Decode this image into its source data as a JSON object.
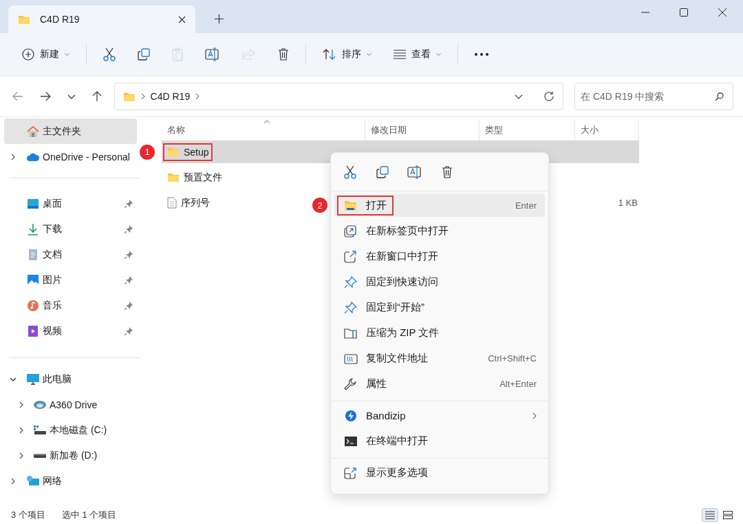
{
  "window": {
    "tab_title": "C4D R19"
  },
  "toolbar": [
    {
      "kind": "new",
      "label": "新建",
      "disabled": false
    },
    {
      "kind": "cut",
      "disabled": false
    },
    {
      "kind": "copy",
      "disabled": false
    },
    {
      "kind": "paste",
      "disabled": true
    },
    {
      "kind": "rename",
      "disabled": false
    },
    {
      "kind": "share",
      "disabled": true
    },
    {
      "kind": "delete",
      "disabled": false
    },
    {
      "kind": "sort",
      "label": "排序",
      "disabled": false
    },
    {
      "kind": "view",
      "label": "查看",
      "disabled": false
    },
    {
      "kind": "more",
      "disabled": false
    }
  ],
  "address": {
    "path": [
      "C4D R19"
    ],
    "search_placeholder": "在 C4D R19 中搜索"
  },
  "sidebar": {
    "groups": [
      [
        {
          "kind": "home",
          "label": "主文件夹",
          "selected": true
        },
        {
          "kind": "cloud",
          "label": "OneDrive - Personal",
          "selected": false,
          "expanded": false
        }
      ],
      [
        {
          "kind": "desktop",
          "label": "桌面",
          "selected": false,
          "pinned": true
        },
        {
          "kind": "download",
          "label": "下载",
          "selected": false,
          "pinned": true
        },
        {
          "kind": "document",
          "label": "文档",
          "selected": false,
          "pinned": true
        },
        {
          "kind": "image",
          "label": "图片",
          "selected": false,
          "pinned": true
        },
        {
          "kind": "music",
          "label": "音乐",
          "selected": false,
          "pinned": true
        },
        {
          "kind": "video",
          "label": "视频",
          "selected": false,
          "pinned": true
        }
      ],
      [
        {
          "kind": "pc",
          "label": "此电脑",
          "selected": false,
          "expanded": true,
          "children": [
            {
              "kind": "cloud-drive",
              "label": "A360 Drive",
              "selected": false,
              "expanded": false
            },
            {
              "kind": "disk-c",
              "label": "本地磁盘 (C:)",
              "selected": false,
              "expanded": false
            },
            {
              "kind": "disk",
              "label": "新加卷 (D:)",
              "selected": false,
              "expanded": false
            }
          ]
        },
        {
          "kind": "network",
          "label": "网络",
          "selected": false,
          "expanded": false
        }
      ]
    ]
  },
  "file_list": {
    "columns": [
      {
        "label": "名称",
        "sorted": true
      },
      {
        "label": "修改日期",
        "sorted": false
      },
      {
        "label": "类型",
        "sorted": false
      },
      {
        "label": "大小",
        "sorted": false
      }
    ],
    "rows": [
      {
        "kind": "folder",
        "name": "Setup",
        "size": "",
        "selected": true,
        "annotation": "1"
      },
      {
        "kind": "folder",
        "name": "预置文件",
        "size": "",
        "selected": false
      },
      {
        "kind": "file",
        "name": "序列号",
        "size": "1 KB",
        "selected": false
      }
    ]
  },
  "context_menu": {
    "actions": [
      {
        "kind": "cut"
      },
      {
        "kind": "copy"
      },
      {
        "kind": "rename"
      },
      {
        "kind": "delete"
      }
    ],
    "groups": [
      [
        {
          "kind": "folder-open",
          "label": "打开",
          "shortcut": "Enter",
          "selected": true,
          "annotation": "2"
        },
        {
          "kind": "new-tab",
          "label": "在新标签页中打开",
          "selected": false
        },
        {
          "kind": "new-window",
          "label": "在新窗口中打开",
          "selected": false
        },
        {
          "kind": "pin",
          "label": "固定到快速访问",
          "selected": false
        },
        {
          "kind": "pin",
          "label": "固定到“开始”",
          "selected": false
        },
        {
          "kind": "zip",
          "label": "压缩为 ZIP 文件",
          "selected": false
        },
        {
          "kind": "path",
          "label": "复制文件地址",
          "shortcut": "Ctrl+Shift+C",
          "selected": false
        },
        {
          "kind": "wrench",
          "label": "属性",
          "shortcut": "Alt+Enter",
          "selected": false
        }
      ],
      [
        {
          "kind": "bandizip",
          "label": "Bandizip",
          "selected": false,
          "submenu": true
        },
        {
          "kind": "terminal",
          "label": "在终端中打开",
          "selected": false
        }
      ],
      [
        {
          "kind": "more-options",
          "label": "显示更多选项",
          "selected": false
        }
      ]
    ]
  },
  "status_bar": {
    "item_count": "3 个项目",
    "selection": "选中 1 个项目",
    "views": [
      {
        "kind": "details",
        "selected": true
      },
      {
        "kind": "tiles",
        "selected": false
      }
    ]
  }
}
